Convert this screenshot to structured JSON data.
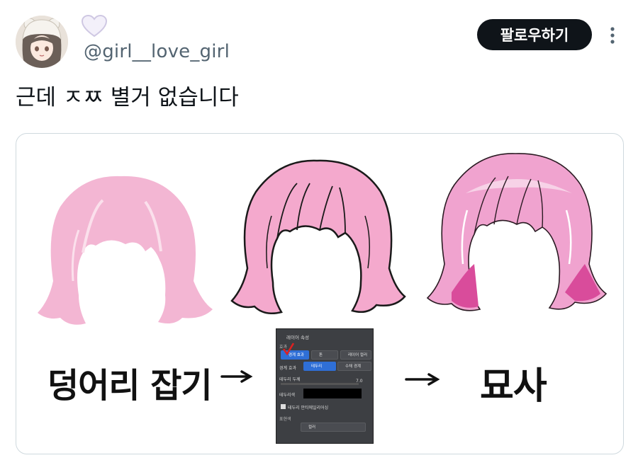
{
  "header": {
    "handle": "@girl__love_girl",
    "follow_label": "팔로우하기"
  },
  "tweet": {
    "text": "근데 ㅈㅉ 별거 없습니다"
  },
  "media": {
    "caption_left": "덩어리 잡기",
    "caption_right": "묘사",
    "arrow1": "→",
    "arrow2": "→",
    "panel": {
      "title": "레이어 속성",
      "section_effect": "효과",
      "chip_border_effect": "경계 효과",
      "chip_tone": "톤",
      "chip_layer_color": "레이어 컬러",
      "row_border_effect": "경계 효과",
      "chip_border": "테두리",
      "chip_watercolor": "수채 경계",
      "row_border_width": "테두리 두께",
      "border_width_value": "7.0",
      "row_border_color": "테두리색",
      "checkbox_label": "테두리 안티에일리어싱",
      "section_expression": "표현색",
      "select_value": "컬러"
    }
  },
  "colors": {
    "follow_bg": "#0f1419",
    "handle_gray": "#536471",
    "hair_flat": "#f3b6d3",
    "hair_line": "#ee8fbe",
    "hair_render": "#e97fbd"
  }
}
